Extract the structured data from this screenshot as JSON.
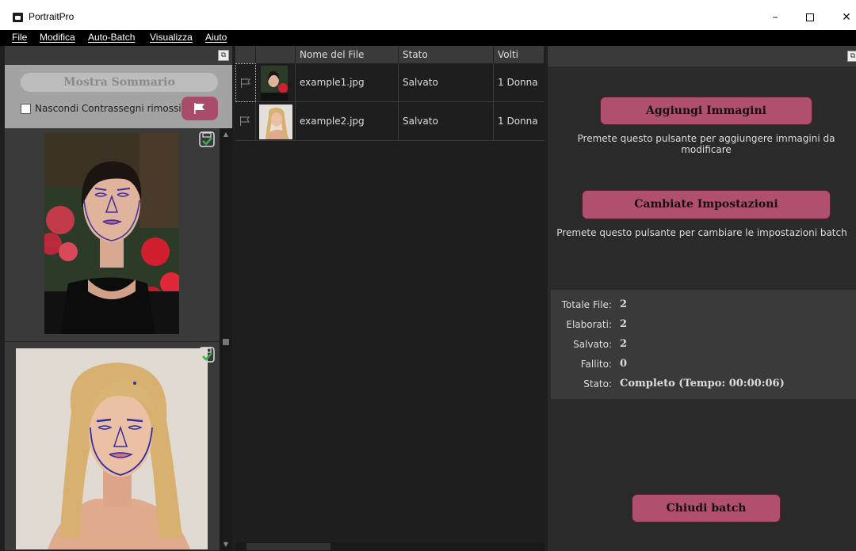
{
  "window": {
    "title": "PortraitPro",
    "minimize": "–",
    "close": "✕"
  },
  "menu": [
    "File",
    "Modifica",
    "Auto-Batch",
    "Visualizza",
    "Aiuto"
  ],
  "left_panel": {
    "summary_button": "Mostra Sommario",
    "hide_flags_label": "Nascondi Contrassegni rimossi",
    "hide_flags_checked": false
  },
  "table": {
    "columns": [
      "Nome del File",
      "Stato",
      "Volti"
    ],
    "rows": [
      {
        "file": "example1.jpg",
        "status": "Salvato",
        "faces": "1 Donna"
      },
      {
        "file": "example2.jpg",
        "status": "Salvato",
        "faces": "1 Donna"
      }
    ]
  },
  "right_panel": {
    "add_button": "Aggiungi Immagini",
    "add_desc": "Premete questo pulsante per aggiungere immagini da modificare",
    "settings_button": "Cambiate Impostazioni",
    "settings_desc": "Premete questo pulsante per cambiare le impostazioni batch",
    "stats": [
      {
        "label": "Totale File:",
        "value": "2"
      },
      {
        "label": "Elaborati:",
        "value": "2"
      },
      {
        "label": "Salvato:",
        "value": "2"
      },
      {
        "label": "Fallito:",
        "value": "0"
      },
      {
        "label": "Stato:",
        "value": "Completo (Tempo: 00:00:06)"
      }
    ],
    "close_button": "Chiudi batch"
  },
  "colors": {
    "accent": "#b0506e",
    "panel": "#2a2a2a",
    "summary_bg": "#a3a3a3"
  },
  "icons": [
    "app-icon",
    "restore-icon",
    "flag-icon",
    "save-check-icon",
    "chevron-up-icon",
    "chevron-down-icon"
  ]
}
